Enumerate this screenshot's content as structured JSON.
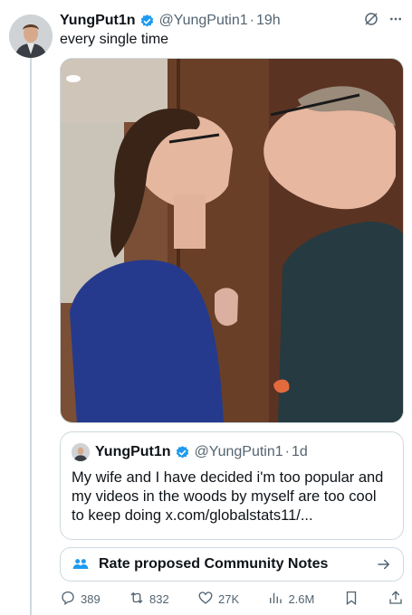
{
  "tweet": {
    "display_name": "YungPut1n",
    "handle": "@YungPutin1",
    "separator": "·",
    "time": "19h",
    "text": "every single time"
  },
  "quote": {
    "display_name": "YungPut1n",
    "handle": "@YungPutin1",
    "separator": "·",
    "time": "1d",
    "text": "My wife and I have decided i'm too popular and my videos in the woods by myself are too cool to keep doing x.com/globalstats11/..."
  },
  "community_notes": {
    "label": "Rate proposed Community Notes"
  },
  "actions": {
    "replies": "389",
    "reposts": "832",
    "likes": "27K",
    "views": "2.6M"
  },
  "colors": {
    "verified": "#1d9bf0",
    "muted": "#536471",
    "border": "#cfd9de"
  },
  "icons": [
    "verified-badge-icon",
    "grok-icon",
    "more-icon",
    "community-notes-icon",
    "arrow-right-icon",
    "reply-icon",
    "repost-icon",
    "like-icon",
    "views-icon",
    "bookmark-icon",
    "share-icon"
  ]
}
